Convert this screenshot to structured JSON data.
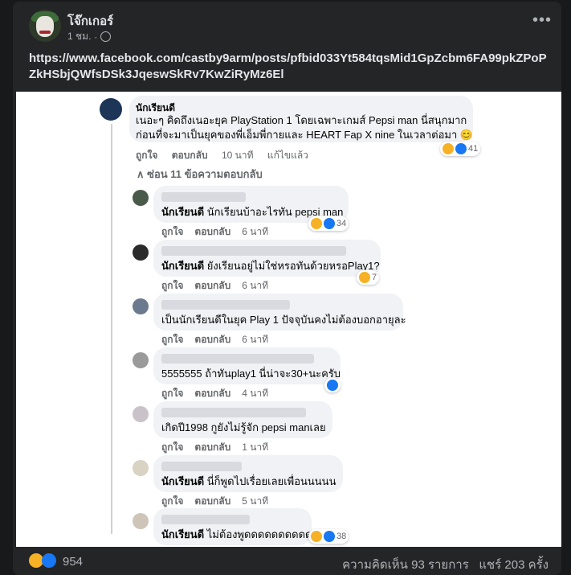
{
  "post": {
    "author": "โจ๊กเกอร์",
    "time": "1 ชม.",
    "dot": "·",
    "more": "•••",
    "text": "https://www.facebook.com/castby9arm/posts/pfbid033Yt584tqsMid1GpZcbm6FA99pkZPoPZkHSbjQWfsDSk3JqeswSkRv7KwZiRyMz6El"
  },
  "main_comment": {
    "name": "นักเรียนดี",
    "line1": "เนอะๆ คิดถึงเนอะยุค PlayStation 1 โดยเฉพาะเกมส์ Pepsi man นี่สนุกมาก",
    "line2": "ก่อนที่จะมาเป็นยุคของพี่เอ็มพี่กายและ HEART Fap X nine ในเวลาต่อมา 😊",
    "like": "ถูกใจ",
    "reply": "ตอบกลับ",
    "time": "10 นาที",
    "edited": "แก้ไขแล้ว",
    "reactions": "41"
  },
  "hide_replies": "∧  ซ่อน 11 ข้อความตอบกลับ",
  "replies": [
    {
      "tag": "นักเรียนดี",
      "text": "นักเรียนบ้าอะไรทัน pepsi man",
      "time": "6 นาที",
      "reactions": "34"
    },
    {
      "tag": "นักเรียนดี",
      "text": "ยังเรียนอยู่ไม่ใช่หรอทันด้วยหรอPlay1?",
      "time": "6 นาที",
      "reactions": "7"
    },
    {
      "tag": "",
      "text": "เป็นนักเรียนดีในยุค Play 1 ปัจจุบันคงไม่ต้องบอกอายุละ",
      "time": "6 นาที",
      "reactions": ""
    },
    {
      "tag": "",
      "text": "5555555 ถ้าทันplay1 นี่น่าจะ30+นะครับ",
      "time": "4 นาที",
      "reactions": ""
    },
    {
      "tag": "",
      "text": "เกิดปี1998 กูยังไม่รู้จัก pepsi manเลย",
      "time": "1 นาที",
      "reactions": ""
    },
    {
      "tag": "นักเรียนดี",
      "text": "นี่ก็พูดไปเรื่อยเลยเพื่อนนนนน",
      "time": "5 นาที",
      "reactions": ""
    },
    {
      "tag": "นักเรียนดี",
      "text": "ไม่ต้องพูดดดดดดดดดด",
      "time": "",
      "reactions": "38"
    }
  ],
  "reply_actions": {
    "like": "ถูกใจ",
    "reply": "ตอบกลับ"
  },
  "footer": {
    "reaction_count": "954",
    "comments": "ความคิดเห็น 93 รายการ",
    "shares": "แชร์ 203 ครั้ง"
  },
  "colors": {
    "haha": "#f7b125",
    "like": "#1877f2",
    "bg": "#242526"
  }
}
